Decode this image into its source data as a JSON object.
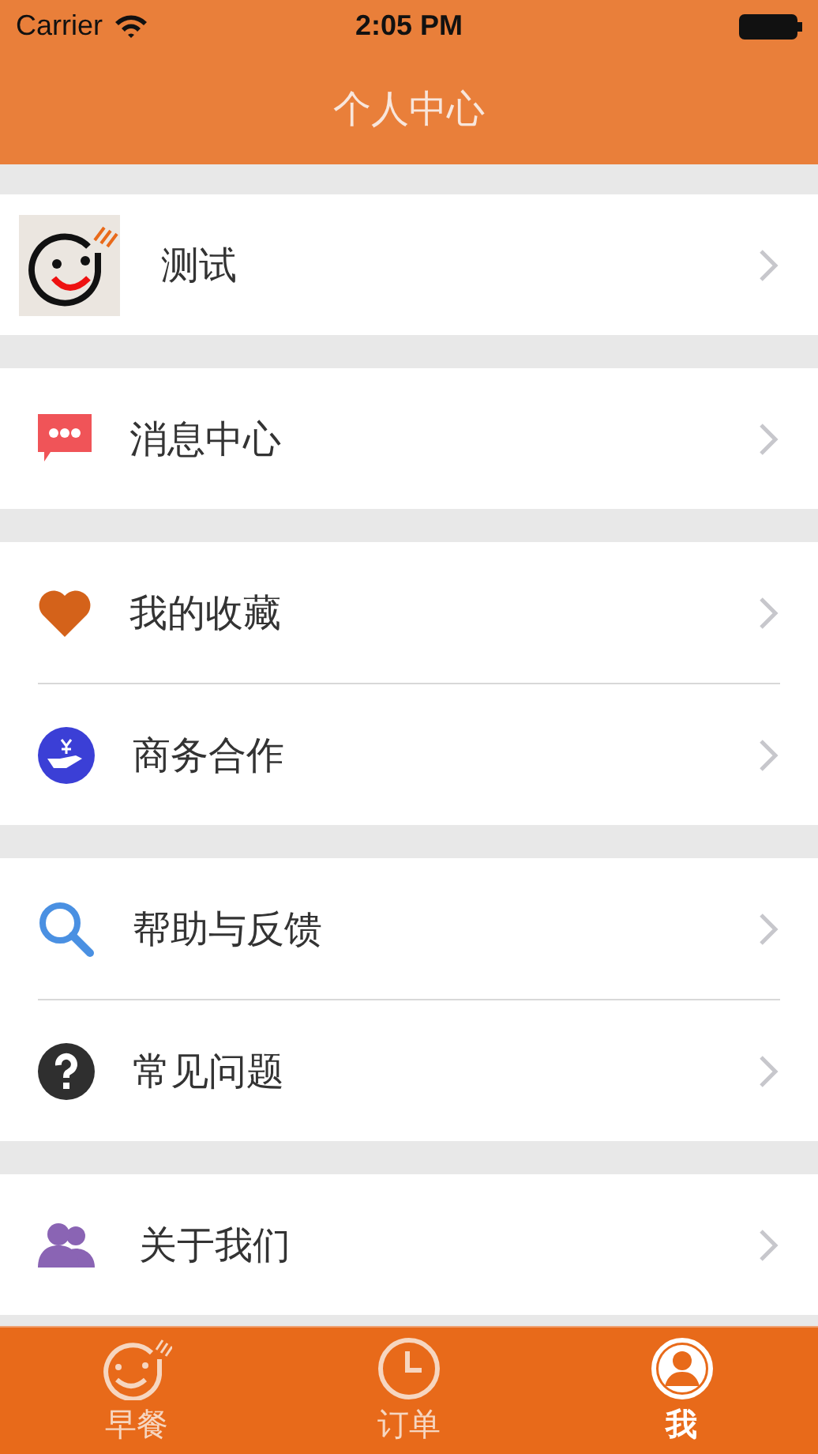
{
  "status_bar": {
    "carrier": "Carrier",
    "time": "2:05 PM"
  },
  "nav_bar": {
    "title": "个人中心"
  },
  "sections": [
    {
      "items": [
        {
          "kind": "profile",
          "label": "测试"
        }
      ]
    },
    {
      "items": [
        {
          "kind": "message",
          "label": "消息中心"
        }
      ]
    },
    {
      "items": [
        {
          "kind": "heart",
          "label": "我的收藏"
        },
        {
          "kind": "business",
          "label": "商务合作"
        }
      ]
    },
    {
      "items": [
        {
          "kind": "search",
          "label": "帮助与反馈"
        },
        {
          "kind": "question",
          "label": "常见问题"
        }
      ]
    },
    {
      "items": [
        {
          "kind": "people",
          "label": "关于我们"
        }
      ]
    }
  ],
  "tab_bar": [
    {
      "kind": "smile",
      "label": "早餐",
      "selected": false
    },
    {
      "kind": "clock",
      "label": "订单",
      "selected": false
    },
    {
      "kind": "person",
      "label": "我",
      "selected": true
    }
  ]
}
